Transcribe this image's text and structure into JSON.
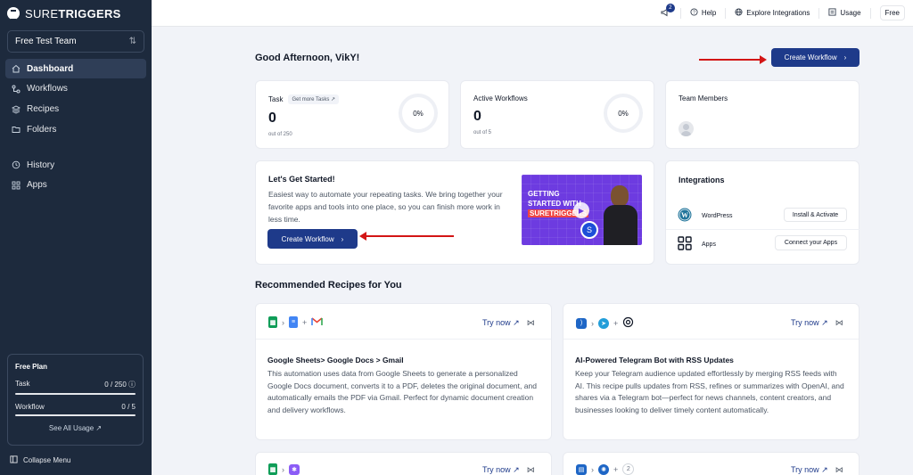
{
  "sidebar": {
    "logo": {
      "thin": "SURE",
      "bold": "TRIGGERS"
    },
    "team": "Free Test Team",
    "nav": [
      {
        "label": "Dashboard",
        "icon": "home-icon"
      },
      {
        "label": "Workflows",
        "icon": "workflow-icon"
      },
      {
        "label": "Recipes",
        "icon": "layers-icon"
      },
      {
        "label": "Folders",
        "icon": "folder-icon"
      }
    ],
    "nav2": [
      {
        "label": "History",
        "icon": "history-icon"
      },
      {
        "label": "Apps",
        "icon": "apps-grid-icon"
      }
    ],
    "plan": {
      "title": "Free Plan",
      "task_label": "Task",
      "task_value": "0 / 250",
      "workflow_label": "Workflow",
      "workflow_value": "0 / 5",
      "link": "See All Usage ↗",
      "task_fill": 0,
      "workflow_fill": 0
    },
    "collapse": "Collapse Menu"
  },
  "topbar": {
    "notifications": "2",
    "help": "Help",
    "explore": "Explore Integrations",
    "usage": "Usage",
    "plan": "Free"
  },
  "main": {
    "greeting": "Good Afternoon, VikY!",
    "create_workflow": "Create Workflow",
    "task_card": {
      "label": "Task",
      "get_more": "Get more Tasks ↗",
      "value": "0",
      "sub": "out of 250",
      "percent": "0%"
    },
    "workflow_card": {
      "label": "Active Workflows",
      "value": "0",
      "sub": "out of 5",
      "percent": "0%"
    },
    "team_card": {
      "label": "Team Members"
    },
    "get_started": {
      "title": "Let's Get Started!",
      "desc": "Easiest way to automate your repeating tasks. We bring together your favorite apps and tools into one place, so you can finish more work in less time.",
      "button": "Create Workflow",
      "video_line1": "GETTING",
      "video_line2": "STARTED WITH",
      "video_brand": "SURETRIGGERS"
    },
    "integrations": {
      "title": "Integrations",
      "rows": [
        {
          "name": "WordPress",
          "button": "Install & Activate"
        },
        {
          "name": "Apps",
          "button": "Connect your Apps"
        }
      ]
    },
    "recipes_title": "Recommended Recipes for You",
    "try_now": "Try now ↗",
    "recipes": [
      {
        "title": "Google Sheets> Google Docs > Gmail",
        "desc": "This automation uses data from Google Sheets to generate a personalized Google Docs document, converts it to a PDF, deletes the original document, and automatically emails the PDF via Gmail. Perfect for dynamic document creation and delivery workflows."
      },
      {
        "title": "AI-Powered Telegram Bot with RSS Updates",
        "desc": "Keep your Telegram audience updated effortlessly by merging RSS feeds with AI. This recipe pulls updates from RSS, refines or summarizes with OpenAI, and shares via a Telegram bot—perfect for news channels, content creators, and businesses looking to deliver timely content automatically."
      }
    ],
    "extra_count": "2"
  },
  "colors": {
    "sidebar": "#1d2a3d",
    "primary": "#1e3a8a",
    "annotation": "#d31515"
  }
}
